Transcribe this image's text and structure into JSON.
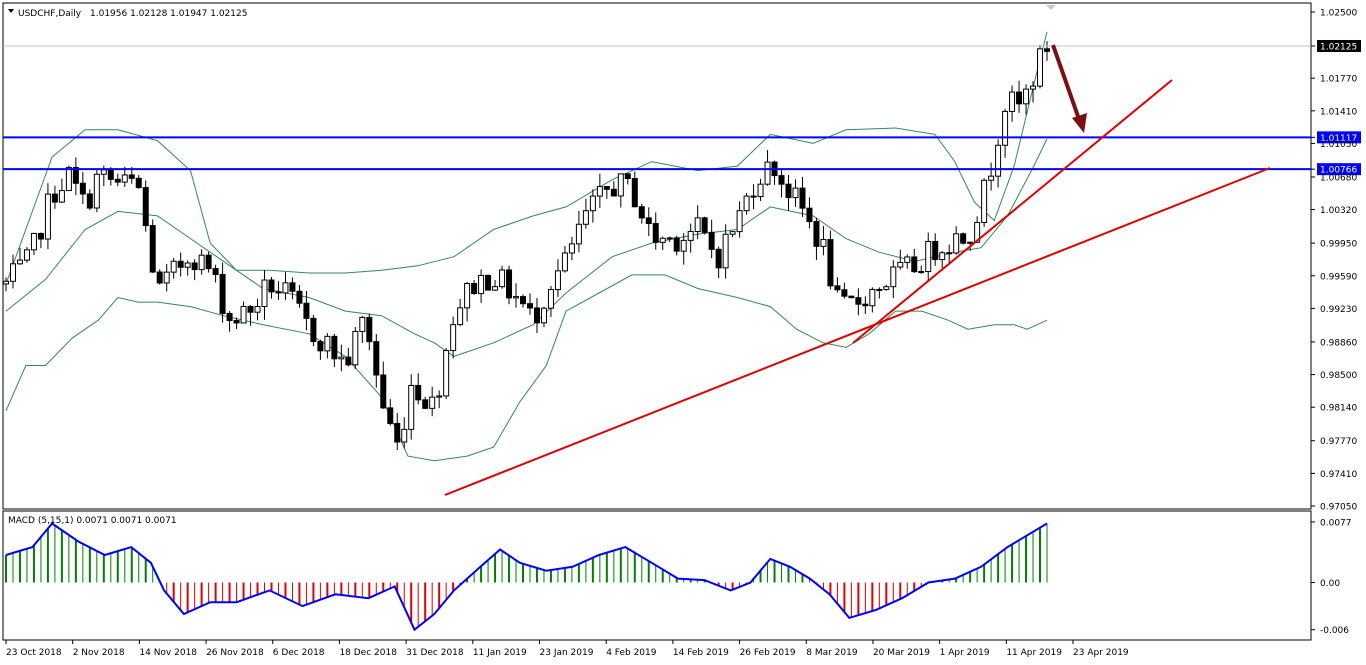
{
  "header": {
    "symbol": "USDCHF,Daily",
    "ohlc": "1.01956 1.02128 1.01947 1.02125"
  },
  "colors": {
    "background": "#ffffff",
    "candle": "#000000",
    "bollinger": "#2e8b57",
    "hline": "#0000ff",
    "trendline": "#e00000",
    "arrow": "#7a1010",
    "macd_line": "#0000ff",
    "hist_pos": "#008000",
    "hist_neg": "#e00000",
    "grid_label_bg": "#000000"
  },
  "chart_data": [
    {
      "type": "candlestick",
      "title": "USDCHF,Daily",
      "y_ticks": [
        "1.02500",
        "1.02125",
        "1.01770",
        "1.01410",
        "1.01117",
        "1.01050",
        "1.00766",
        "1.00680",
        "1.00320",
        "0.99950",
        "0.99590",
        "0.99230",
        "0.98860",
        "0.98500",
        "0.98140",
        "0.97770",
        "0.97410",
        "0.97050"
      ],
      "ylim": [
        0.9705,
        1.025
      ],
      "current_price": 1.02125,
      "current_price_label": "1.02125",
      "horizontal_levels": [
        {
          "value": 1.01117,
          "label": "1.01117"
        },
        {
          "value": 1.00766,
          "label": "1.00766"
        }
      ],
      "x_ticks": [
        "23 Oct 2018",
        "2 Nov 2018",
        "14 Nov 2018",
        "26 Nov 2018",
        "6 Dec 2018",
        "18 Dec 2018",
        "31 Dec 2018",
        "11 Jan 2019",
        "23 Jan 2019",
        "4 Feb 2019",
        "14 Feb 2019",
        "26 Feb 2019",
        "8 Mar 2019",
        "20 Mar 2019",
        "1 Apr 2019",
        "11 Apr 2019",
        "23 Apr 2019"
      ],
      "candle_count": 150,
      "close_path": [
        [
          0,
          0.995
        ],
        [
          7,
          0.9975
        ],
        [
          14,
          1.005
        ],
        [
          19,
          1.007
        ],
        [
          24,
          1.0035
        ],
        [
          28,
          1.007
        ],
        [
          34,
          1.006
        ],
        [
          40,
          1.006
        ],
        [
          46,
          0.994
        ],
        [
          56,
          0.9985
        ],
        [
          62,
          0.9965
        ],
        [
          68,
          0.991
        ],
        [
          74,
          0.992
        ],
        [
          80,
          0.995
        ],
        [
          86,
          0.9935
        ],
        [
          92,
          0.99
        ],
        [
          97,
          0.9885
        ],
        [
          103,
          0.986
        ],
        [
          109,
          0.9915
        ],
        [
          114,
          0.982
        ],
        [
          119,
          0.977
        ],
        [
          123,
          0.984
        ],
        [
          130,
          0.9815
        ],
        [
          136,
          0.992
        ],
        [
          142,
          0.995
        ],
        [
          148,
          0.996
        ],
        [
          155,
          0.9935
        ],
        [
          160,
          0.991
        ],
        [
          165,
          0.995
        ],
        [
          170,
          0.9975
        ],
        [
          176,
          1.0025
        ],
        [
          184,
          1.006
        ],
        [
          190,
          1.0055
        ],
        [
          196,
          1.0
        ],
        [
          203,
          1.0
        ],
        [
          210,
          1.001
        ],
        [
          216,
          0.998
        ],
        [
          222,
          1.002
        ],
        [
          228,
          1.007
        ],
        [
          233,
          1.008
        ],
        [
          238,
          1.005
        ],
        [
          242,
          1.003
        ],
        [
          248,
          0.999
        ],
        [
          253,
          0.992
        ],
        [
          258,
          0.993
        ],
        [
          264,
          0.9945
        ],
        [
          270,
          0.996
        ],
        [
          276,
          0.997
        ],
        [
          282,
          0.999
        ],
        [
          288,
          1.0
        ],
        [
          292,
          1.0005
        ],
        [
          296,
          1.004
        ],
        [
          299,
          1.008
        ],
        [
          303,
          1.015
        ],
        [
          308,
          1.0145
        ],
        [
          313,
          1.019
        ],
        [
          316,
          1.0212
        ]
      ],
      "bollinger_upper_path": [
        [
          0,
          0.995
        ],
        [
          14,
          1.009
        ],
        [
          24,
          1.012
        ],
        [
          34,
          1.012
        ],
        [
          46,
          1.0108
        ],
        [
          56,
          1.0075
        ],
        [
          62,
          0.9995
        ],
        [
          70,
          0.9965
        ],
        [
          80,
          0.9965
        ],
        [
          92,
          0.9962
        ],
        [
          103,
          0.9962
        ],
        [
          114,
          0.9965
        ],
        [
          125,
          0.997
        ],
        [
          136,
          0.998
        ],
        [
          148,
          1.001
        ],
        [
          160,
          1.0025
        ],
        [
          170,
          1.0035
        ],
        [
          184,
          1.0065
        ],
        [
          196,
          1.0085
        ],
        [
          210,
          1.0075
        ],
        [
          222,
          1.008
        ],
        [
          232,
          1.0115
        ],
        [
          245,
          1.0105
        ],
        [
          255,
          1.012
        ],
        [
          270,
          1.0122
        ],
        [
          282,
          1.0115
        ],
        [
          288,
          1.0085
        ],
        [
          294,
          1.004
        ],
        [
          300,
          1.002
        ],
        [
          306,
          1.008
        ],
        [
          312,
          1.017
        ],
        [
          316,
          1.0228
        ]
      ],
      "bollinger_middle_path": [
        [
          0,
          0.992
        ],
        [
          12,
          0.9955
        ],
        [
          24,
          1.001
        ],
        [
          34,
          1.003
        ],
        [
          46,
          1.0025
        ],
        [
          56,
          1.0
        ],
        [
          66,
          0.9975
        ],
        [
          78,
          0.9945
        ],
        [
          92,
          0.9935
        ],
        [
          103,
          0.992
        ],
        [
          114,
          0.9915
        ],
        [
          124,
          0.9895
        ],
        [
          130,
          0.9885
        ],
        [
          136,
          0.987
        ],
        [
          148,
          0.9885
        ],
        [
          160,
          0.9905
        ],
        [
          170,
          0.994
        ],
        [
          184,
          0.998
        ],
        [
          196,
          0.9995
        ],
        [
          210,
          1.0005
        ],
        [
          222,
          1.001
        ],
        [
          232,
          1.0035
        ],
        [
          245,
          1.0025
        ],
        [
          255,
          1.0
        ],
        [
          265,
          0.9985
        ],
        [
          276,
          0.9975
        ],
        [
          288,
          0.9985
        ],
        [
          296,
          0.999
        ],
        [
          304,
          1.0025
        ],
        [
          312,
          1.008
        ],
        [
          316,
          1.011
        ]
      ],
      "bollinger_lower_path": [
        [
          0,
          0.981
        ],
        [
          6,
          0.986
        ],
        [
          12,
          0.986
        ],
        [
          20,
          0.989
        ],
        [
          28,
          0.991
        ],
        [
          34,
          0.9935
        ],
        [
          40,
          0.993
        ],
        [
          46,
          0.993
        ],
        [
          56,
          0.9925
        ],
        [
          66,
          0.9915
        ],
        [
          78,
          0.9905
        ],
        [
          92,
          0.9895
        ],
        [
          103,
          0.987
        ],
        [
          114,
          0.9825
        ],
        [
          122,
          0.976
        ],
        [
          130,
          0.9755
        ],
        [
          140,
          0.976
        ],
        [
          148,
          0.977
        ],
        [
          156,
          0.982
        ],
        [
          164,
          0.986
        ],
        [
          170,
          0.992
        ],
        [
          180,
          0.994
        ],
        [
          190,
          0.996
        ],
        [
          200,
          0.996
        ],
        [
          210,
          0.9945
        ],
        [
          222,
          0.9935
        ],
        [
          232,
          0.9925
        ],
        [
          240,
          0.99
        ],
        [
          248,
          0.9885
        ],
        [
          255,
          0.988
        ],
        [
          262,
          0.9895
        ],
        [
          270,
          0.992
        ],
        [
          278,
          0.992
        ],
        [
          286,
          0.991
        ],
        [
          292,
          0.99
        ],
        [
          300,
          0.9905
        ],
        [
          306,
          0.9905
        ],
        [
          310,
          0.99
        ],
        [
          316,
          0.991
        ]
      ],
      "trendlines": [
        {
          "from": [
            0,
            0.9718
          ],
          "to": [
            316,
            1.0145
          ]
        },
        {
          "from": [
            0,
            0.9718
          ],
          "to": [
            316,
            1.0145
          ]
        }
      ]
    },
    {
      "type": "macd",
      "title": "MACD (5,15,1) 0.0071 0.0071 0.0071",
      "y_ticks": [
        "0.0077",
        "0.00",
        "-0.006"
      ],
      "ylim": [
        -0.0068,
        0.0082
      ],
      "macd_path": [
        [
          0,
          0.0035
        ],
        [
          8,
          0.0045
        ],
        [
          14,
          0.0075
        ],
        [
          22,
          0.0052
        ],
        [
          30,
          0.0035
        ],
        [
          38,
          0.0045
        ],
        [
          44,
          0.0025
        ],
        [
          48,
          -0.001
        ],
        [
          54,
          -0.004
        ],
        [
          62,
          -0.0025
        ],
        [
          70,
          -0.0025
        ],
        [
          80,
          -0.001
        ],
        [
          90,
          -0.003
        ],
        [
          100,
          -0.0015
        ],
        [
          110,
          -0.002
        ],
        [
          118,
          -0.0005
        ],
        [
          124,
          -0.006
        ],
        [
          130,
          -0.004
        ],
        [
          136,
          -0.001
        ],
        [
          144,
          0.002
        ],
        [
          150,
          0.0042
        ],
        [
          156,
          0.0025
        ],
        [
          164,
          0.0015
        ],
        [
          172,
          0.002
        ],
        [
          180,
          0.0035
        ],
        [
          188,
          0.0045
        ],
        [
          196,
          0.0025
        ],
        [
          204,
          0.0005
        ],
        [
          212,
          0.0003
        ],
        [
          220,
          -0.001
        ],
        [
          226,
          0.0
        ],
        [
          232,
          0.003
        ],
        [
          238,
          0.002
        ],
        [
          244,
          0.0005
        ],
        [
          250,
          -0.0015
        ],
        [
          256,
          -0.0045
        ],
        [
          264,
          -0.0035
        ],
        [
          272,
          -0.002
        ],
        [
          280,
          0.0
        ],
        [
          288,
          0.0005
        ],
        [
          296,
          0.002
        ],
        [
          304,
          0.0045
        ],
        [
          310,
          0.006
        ],
        [
          316,
          0.0075
        ]
      ],
      "last_value": 0.0071
    }
  ]
}
